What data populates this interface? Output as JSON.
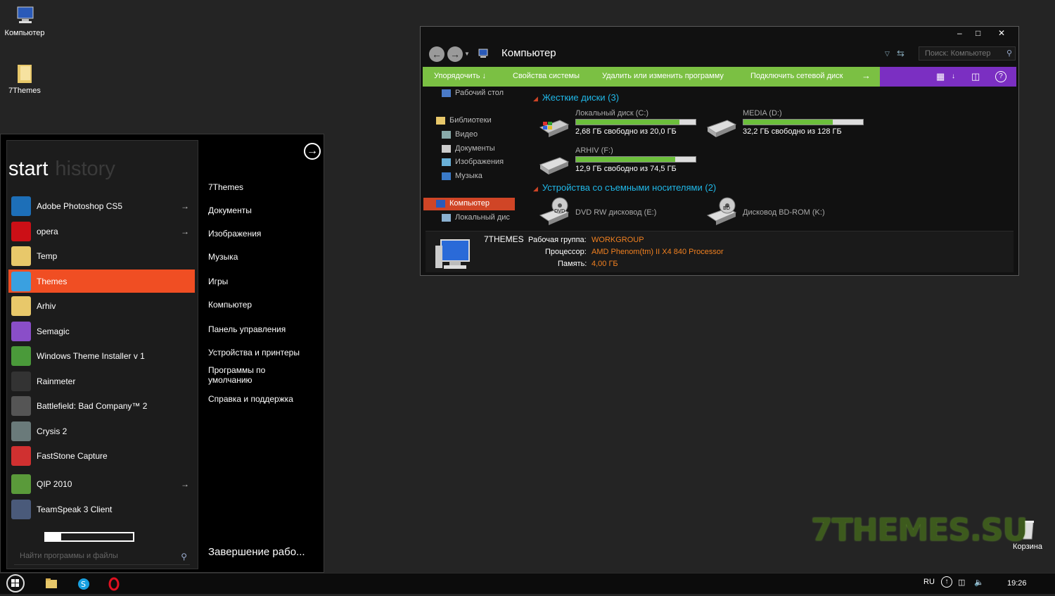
{
  "desktop": {
    "icons": [
      {
        "label": "Компьютер",
        "icon": "computer-icon"
      },
      {
        "label": "7Themes",
        "icon": "folder-icon"
      },
      {
        "label": "Корзина",
        "icon": "recycle-bin-icon"
      }
    ],
    "watermark": "7THEMES.SU"
  },
  "start_menu": {
    "tab_start": "start",
    "tab_history": "history",
    "programs": [
      {
        "label": "Adobe Photoshop CS5",
        "icon": "photoshop-icon",
        "has_arrow": true,
        "color": "#1d6fb8"
      },
      {
        "label": "opera",
        "icon": "opera-icon",
        "has_arrow": true,
        "color": "#cc0f16"
      },
      {
        "label": "Temp",
        "icon": "folder-warning-icon",
        "has_arrow": false,
        "color": "#e8c86a"
      },
      {
        "label": "Themes",
        "icon": "themes-icon",
        "has_arrow": false,
        "color": "#3aa0e0"
      },
      {
        "label": "Arhiv",
        "icon": "folder-icon",
        "has_arrow": false,
        "color": "#e8c86a"
      },
      {
        "label": "Semagic",
        "icon": "semagic-icon",
        "has_arrow": false,
        "color": "#8a4ec8"
      },
      {
        "label": "Windows Theme Installer v 1",
        "icon": "windows-installer-icon",
        "has_arrow": false,
        "color": "#4a9a3a"
      },
      {
        "label": "Rainmeter",
        "icon": "rainmeter-icon",
        "has_arrow": false,
        "color": "#333333"
      },
      {
        "label": "Battlefield: Bad Company™ 2",
        "icon": "battlefield-icon",
        "has_arrow": false,
        "color": "#555555"
      },
      {
        "label": "Crysis 2",
        "icon": "crysis-icon",
        "has_arrow": false,
        "color": "#6a7a7a"
      },
      {
        "label": "FastStone Capture",
        "icon": "faststone-icon",
        "has_arrow": false,
        "color": "#d03030"
      },
      {
        "label": "QIP 2010",
        "icon": "qip-icon",
        "has_arrow": true,
        "color": "#5a9a3a"
      },
      {
        "label": "TeamSpeak 3 Client",
        "icon": "teamspeak-icon",
        "has_arrow": false,
        "color": "#4a5a7a"
      }
    ],
    "active_program_index": 3,
    "progress": 0.18,
    "search_placeholder": "Найти программы и файлы",
    "right_items": [
      "7Themes",
      "Документы",
      "Изображения",
      "Музыка",
      "Игры",
      "Компьютер",
      "Панель управления",
      "Устройства и принтеры",
      "Программы по умолчанию",
      "Справка и поддержка"
    ],
    "shutdown": "Завершение рабо..."
  },
  "explorer": {
    "title": "Компьютер",
    "search_placeholder": "Поиск: Компьютер",
    "toolbar": [
      "Упорядочить",
      "Свойства системы",
      "Удалить или изменить программу",
      "Подключить сетевой диск"
    ],
    "nav": [
      {
        "label": "Рабочий стол",
        "indent": 1,
        "icon": "desktop-icon"
      },
      {
        "label": "Библиотеки",
        "indent": 0,
        "icon": "libraries-icon"
      },
      {
        "label": "Видео",
        "indent": 1,
        "icon": "video-icon"
      },
      {
        "label": "Документы",
        "indent": 1,
        "icon": "documents-icon"
      },
      {
        "label": "Изображения",
        "indent": 1,
        "icon": "pictures-icon"
      },
      {
        "label": "Музыка",
        "indent": 1,
        "icon": "music-icon"
      },
      {
        "label": "Компьютер",
        "indent": 0,
        "icon": "computer-icon"
      },
      {
        "label": "Локальный дис",
        "indent": 1,
        "icon": "drive-icon"
      }
    ],
    "groups": [
      {
        "title": "Жесткие диски (3)"
      },
      {
        "title": "Устройства со съемными носителями (2)"
      }
    ],
    "drives": [
      {
        "name": "Локальный диск (C:)",
        "free": "2,68 ГБ свободно из 20,0 ГБ",
        "used_fraction": 0.866,
        "icon": "system-drive-icon"
      },
      {
        "name": "MEDIA (D:)",
        "free": "32,2 ГБ свободно из 128 ГБ",
        "used_fraction": 0.748,
        "icon": "hard-drive-icon"
      },
      {
        "name": "ARHIV (F:)",
        "free": "12,9 ГБ свободно из 74,5 ГБ",
        "used_fraction": 0.827,
        "icon": "hard-drive-icon"
      }
    ],
    "removable": [
      {
        "name": "DVD RW дисковод (E:)",
        "icon": "dvd-drive-icon",
        "badge": "DVD"
      },
      {
        "name": "Дисковод BD-ROM (K:)",
        "icon": "bd-drive-icon",
        "badge": "BD"
      }
    ],
    "details": {
      "computer_name": "7THEMES",
      "workgroup_label": "Рабочая группа:",
      "workgroup": "WORKGROUP",
      "processor_label": "Процессор:",
      "processor": "AMD Phenom(tm) II X4 840 Processor",
      "memory_label": "Память:",
      "memory": "4,00 ГБ"
    }
  },
  "taskbar": {
    "language": "RU",
    "time": "19:26"
  }
}
